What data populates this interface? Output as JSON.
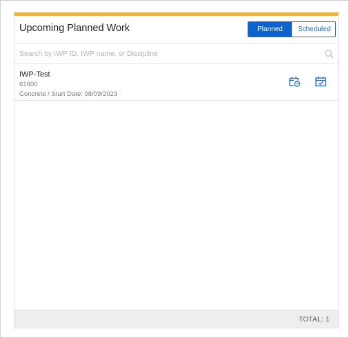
{
  "header": {
    "title": "Upcoming Planned Work",
    "toggle": {
      "planned_label": "Planned",
      "scheduled_label": "Scheduled",
      "selected": "Planned"
    }
  },
  "search": {
    "placeholder": "Search by IWP ID, IWP name, or Discipline",
    "value": ""
  },
  "items": [
    {
      "name": "IWP-Test",
      "id": "61600",
      "meta": "Concrete / Start Date: 08/09/2023",
      "actions": [
        "calendar-clock-icon",
        "calendar-check-icon"
      ]
    }
  ],
  "footer": {
    "total_label": "TOTAL:",
    "total_count": "1",
    "total_text": "TOTAL:  1"
  },
  "colors": {
    "accent_bar": "#e8b54a",
    "toggle_active": "#0b63cf",
    "icon": "#1a66c9"
  }
}
